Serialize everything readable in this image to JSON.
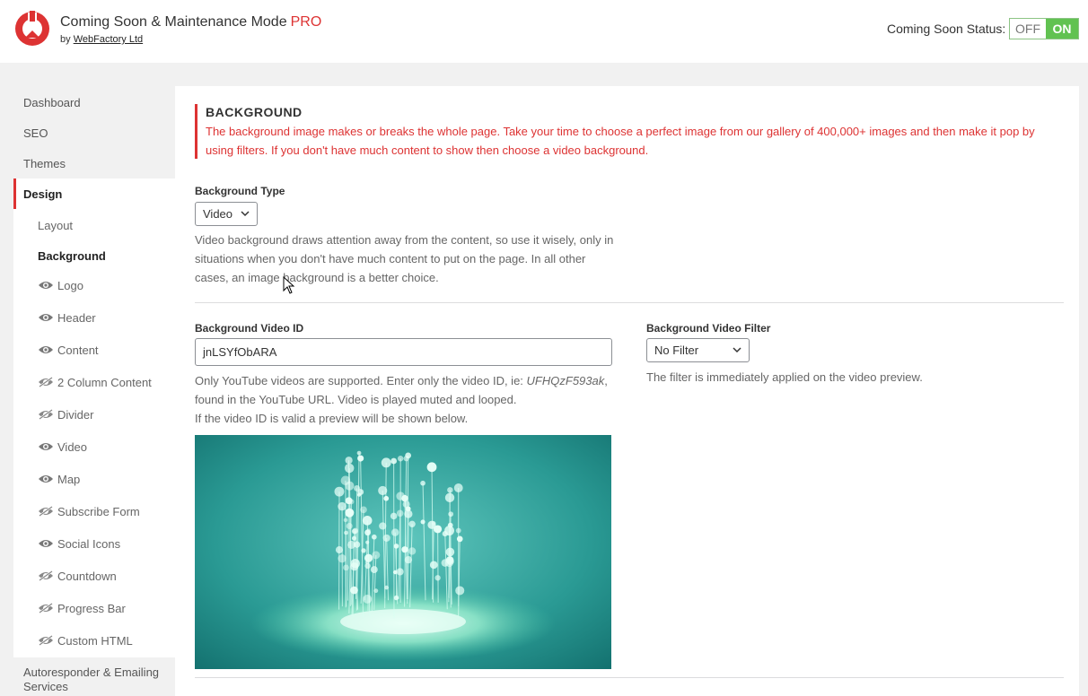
{
  "header": {
    "title": "Coming Soon & Maintenance Mode",
    "pro": "PRO",
    "by_prefix": "by",
    "company": "WebFactory Ltd",
    "status_label": "Coming Soon Status:",
    "toggle_off": "OFF",
    "toggle_on": "ON",
    "brand_color": "#dd3333",
    "on_color": "#61c251"
  },
  "sidebar": {
    "items": [
      {
        "label": "Dashboard"
      },
      {
        "label": "SEO"
      },
      {
        "label": "Themes"
      },
      {
        "label": "Design"
      }
    ],
    "sub_items": [
      {
        "label": "Layout",
        "icon": "none"
      },
      {
        "label": "Background",
        "icon": "none"
      },
      {
        "label": "Logo",
        "icon": "eye-icon"
      },
      {
        "label": "Header",
        "icon": "eye-icon"
      },
      {
        "label": "Content",
        "icon": "eye-icon"
      },
      {
        "label": "2 Column Content",
        "icon": "eye-slash-icon"
      },
      {
        "label": "Divider",
        "icon": "eye-slash-icon"
      },
      {
        "label": "Video",
        "icon": "eye-icon"
      },
      {
        "label": "Map",
        "icon": "eye-icon"
      },
      {
        "label": "Subscribe Form",
        "icon": "eye-slash-icon"
      },
      {
        "label": "Social Icons",
        "icon": "eye-icon"
      },
      {
        "label": "Countdown",
        "icon": "eye-slash-icon"
      },
      {
        "label": "Progress Bar",
        "icon": "eye-slash-icon"
      },
      {
        "label": "Custom HTML",
        "icon": "eye-slash-icon"
      }
    ],
    "last_item": "Autoresponder & Emailing Services"
  },
  "main": {
    "section_title": "BACKGROUND",
    "section_desc": "The background image makes or breaks the whole page. Take your time to choose a perfect image from our gallery of 400,000+ images and then make it pop by using filters. If you don't have much content to show then choose a video background.",
    "bg_type_label": "Background Type",
    "bg_type_value": "Video",
    "bg_type_help": "Video background draws attention away from the content, so use it wisely, only in situations when you don't have much content to put on the page. In all other cases, an image background is a better choice.",
    "video_id_label": "Background Video ID",
    "video_id_value": "jnLSYfObARA",
    "video_help_1": "Only YouTube videos are supported. Enter only the video ID, ie:",
    "video_help_example": "UFHQzF593ak",
    "video_help_2": ", found in the YouTube URL. Video is played muted and looped.",
    "video_help_3": "If the video ID is valid a preview will be shown below.",
    "filter_label": "Background Video Filter",
    "filter_value": "No Filter",
    "filter_help": "The filter is immediately applied on the video preview."
  }
}
